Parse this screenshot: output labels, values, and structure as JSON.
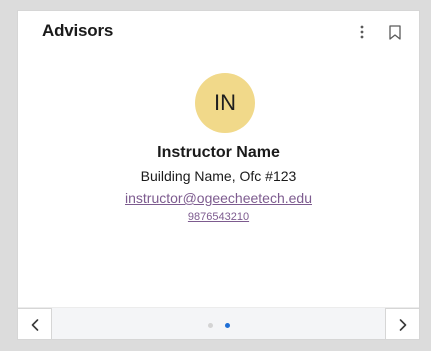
{
  "card": {
    "title": "Advisors",
    "actions": [
      {
        "name": "more-options",
        "icon": "kebab-vertical-icon"
      },
      {
        "name": "bookmark",
        "icon": "bookmark-outline-icon"
      }
    ]
  },
  "advisor": {
    "initials": "IN",
    "name": "Instructor Name",
    "office": "Building Name, Ofc #123",
    "email": "instructor@ogeecheetech.edu",
    "phone": "9876543210"
  },
  "pagination": {
    "total_pages": 2,
    "current_page": 2,
    "prev_icon": "chevron-left-icon",
    "next_icon": "chevron-right-icon"
  },
  "colors": {
    "avatar_bg": "#f1d98a",
    "link": "#7d5b8f",
    "dot_active": "#1f6fd6",
    "dot_inactive": "#d4d4d4",
    "icon": "#5a5a5a"
  }
}
